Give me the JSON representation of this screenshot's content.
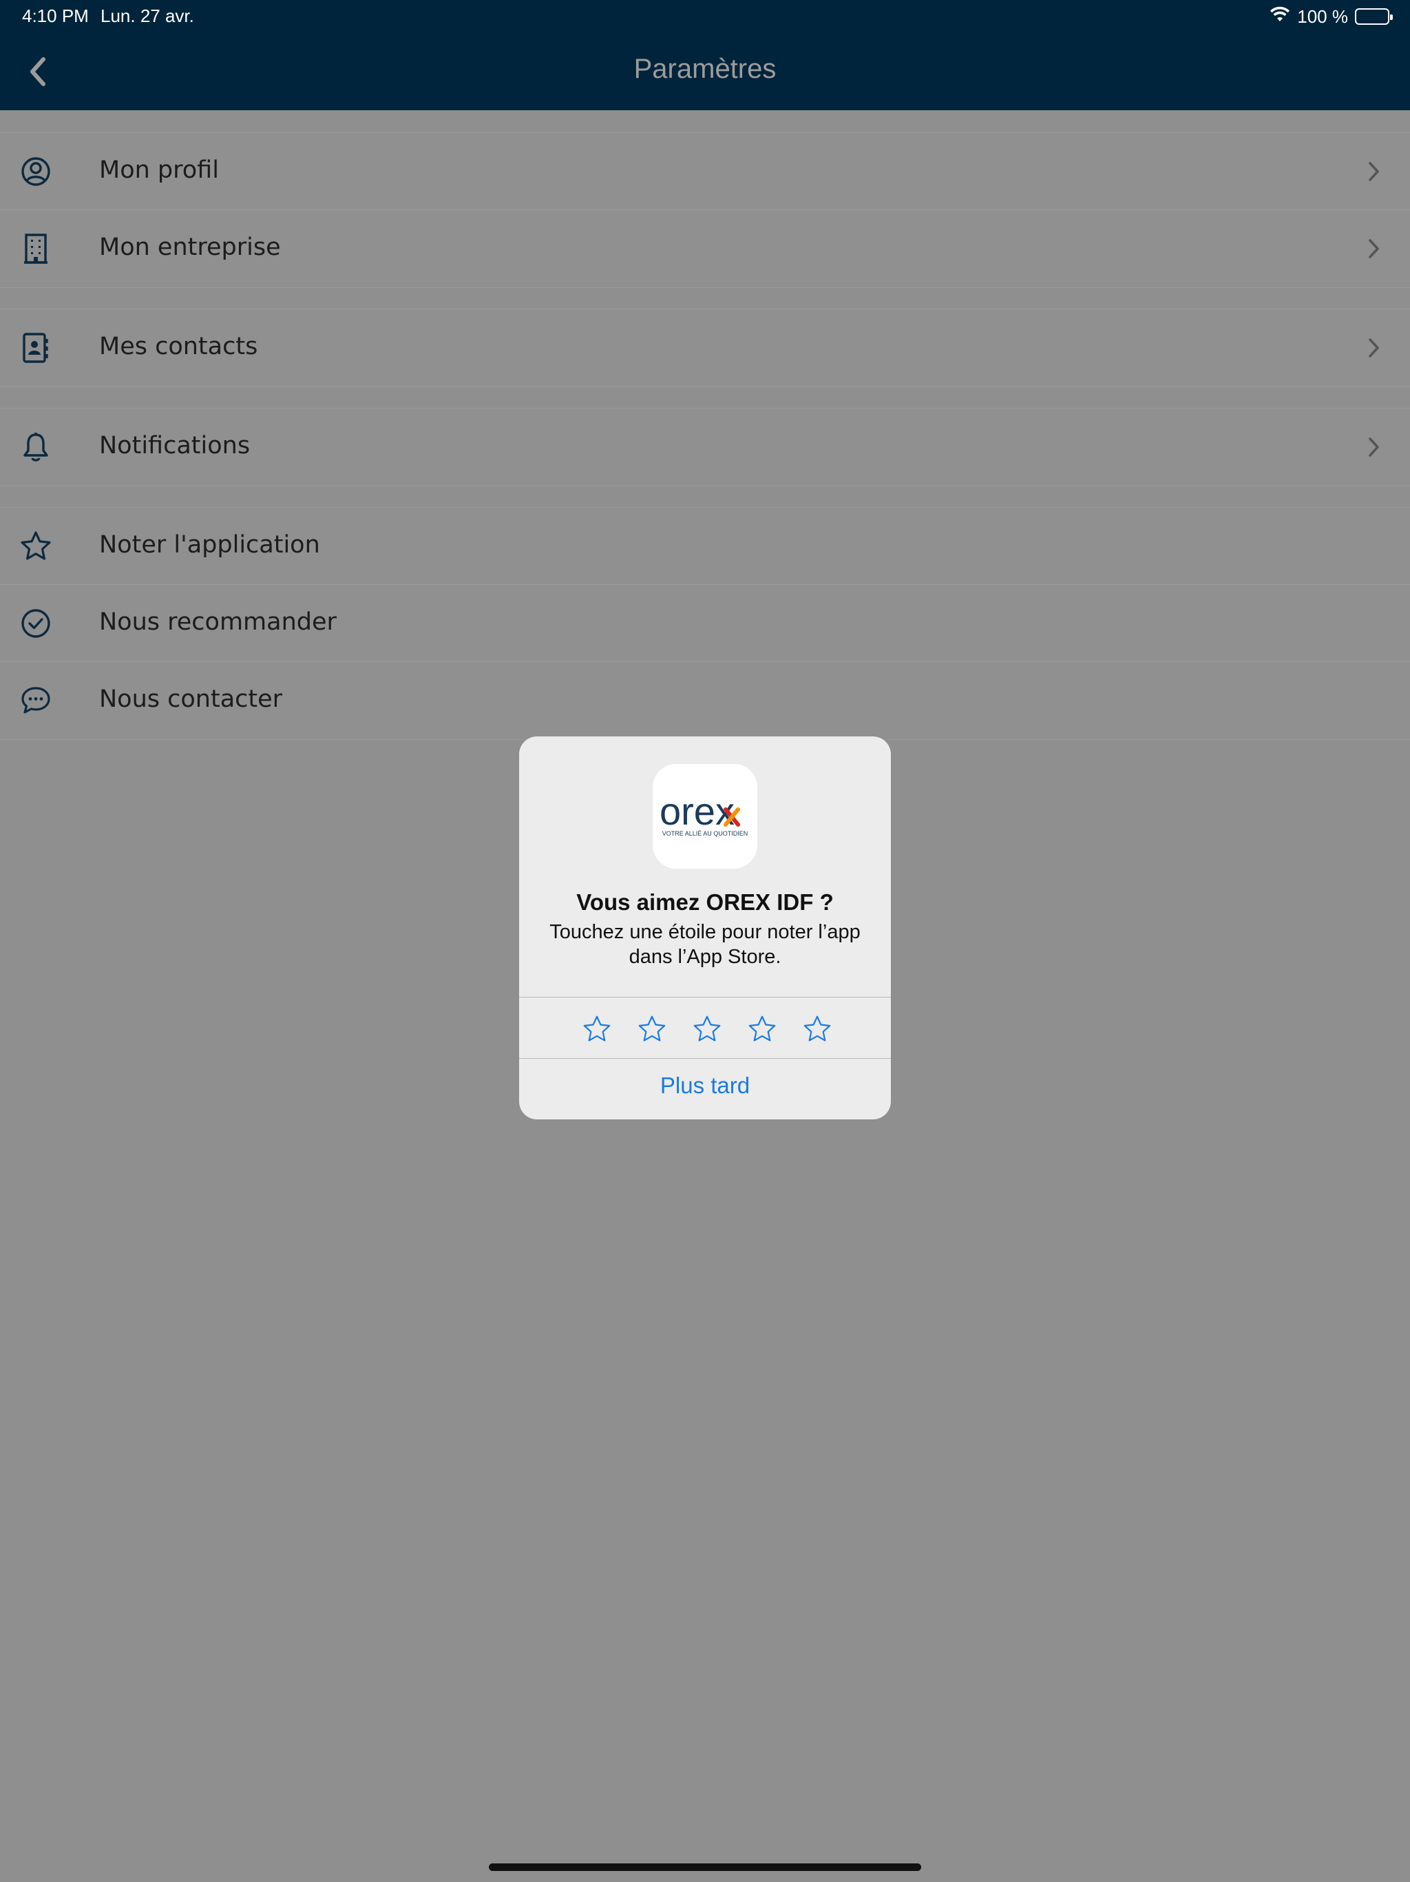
{
  "status_bar": {
    "time": "4:10 PM",
    "date": "Lun. 27 avr.",
    "battery": "100 %",
    "battery_level": 1.0
  },
  "nav": {
    "title": "Paramètres",
    "back_icon": "chevron-left-icon"
  },
  "settings": {
    "groups": [
      {
        "items": [
          {
            "label": "Mon profil",
            "icon": "user-circle-icon",
            "chevron": true
          },
          {
            "label": "Mon entreprise",
            "icon": "building-icon",
            "chevron": true
          }
        ]
      },
      {
        "items": [
          {
            "label": "Mes contacts",
            "icon": "contact-book-icon",
            "chevron": true
          }
        ]
      },
      {
        "items": [
          {
            "label": "Notifications",
            "icon": "bell-icon",
            "chevron": true
          }
        ]
      },
      {
        "items": [
          {
            "label": "Noter l'application",
            "icon": "star-icon",
            "chevron": false
          },
          {
            "label": "Nous recommander",
            "icon": "check-circle-icon",
            "chevron": false
          },
          {
            "label": "Nous contacter",
            "icon": "chat-bubble-icon",
            "chevron": false
          }
        ]
      }
    ]
  },
  "rating_dialog": {
    "app_logo_text": "orex",
    "app_logo_tagline": "VOTRE ALLIÉ AU QUOTIDIEN",
    "title": "Vous aimez OREX IDF ?",
    "message": "Touchez une étoile pour noter l’app dans l’App Store.",
    "stars_count": 5,
    "later_label": "Plus tard"
  },
  "colors": {
    "nav_background": "#00243b",
    "dim_background": "#8f8f8f",
    "accent_blue": "#1a7be0",
    "logo_navy": "#1b3a5c",
    "logo_orange": "#f39200",
    "logo_red": "#d9261c"
  }
}
